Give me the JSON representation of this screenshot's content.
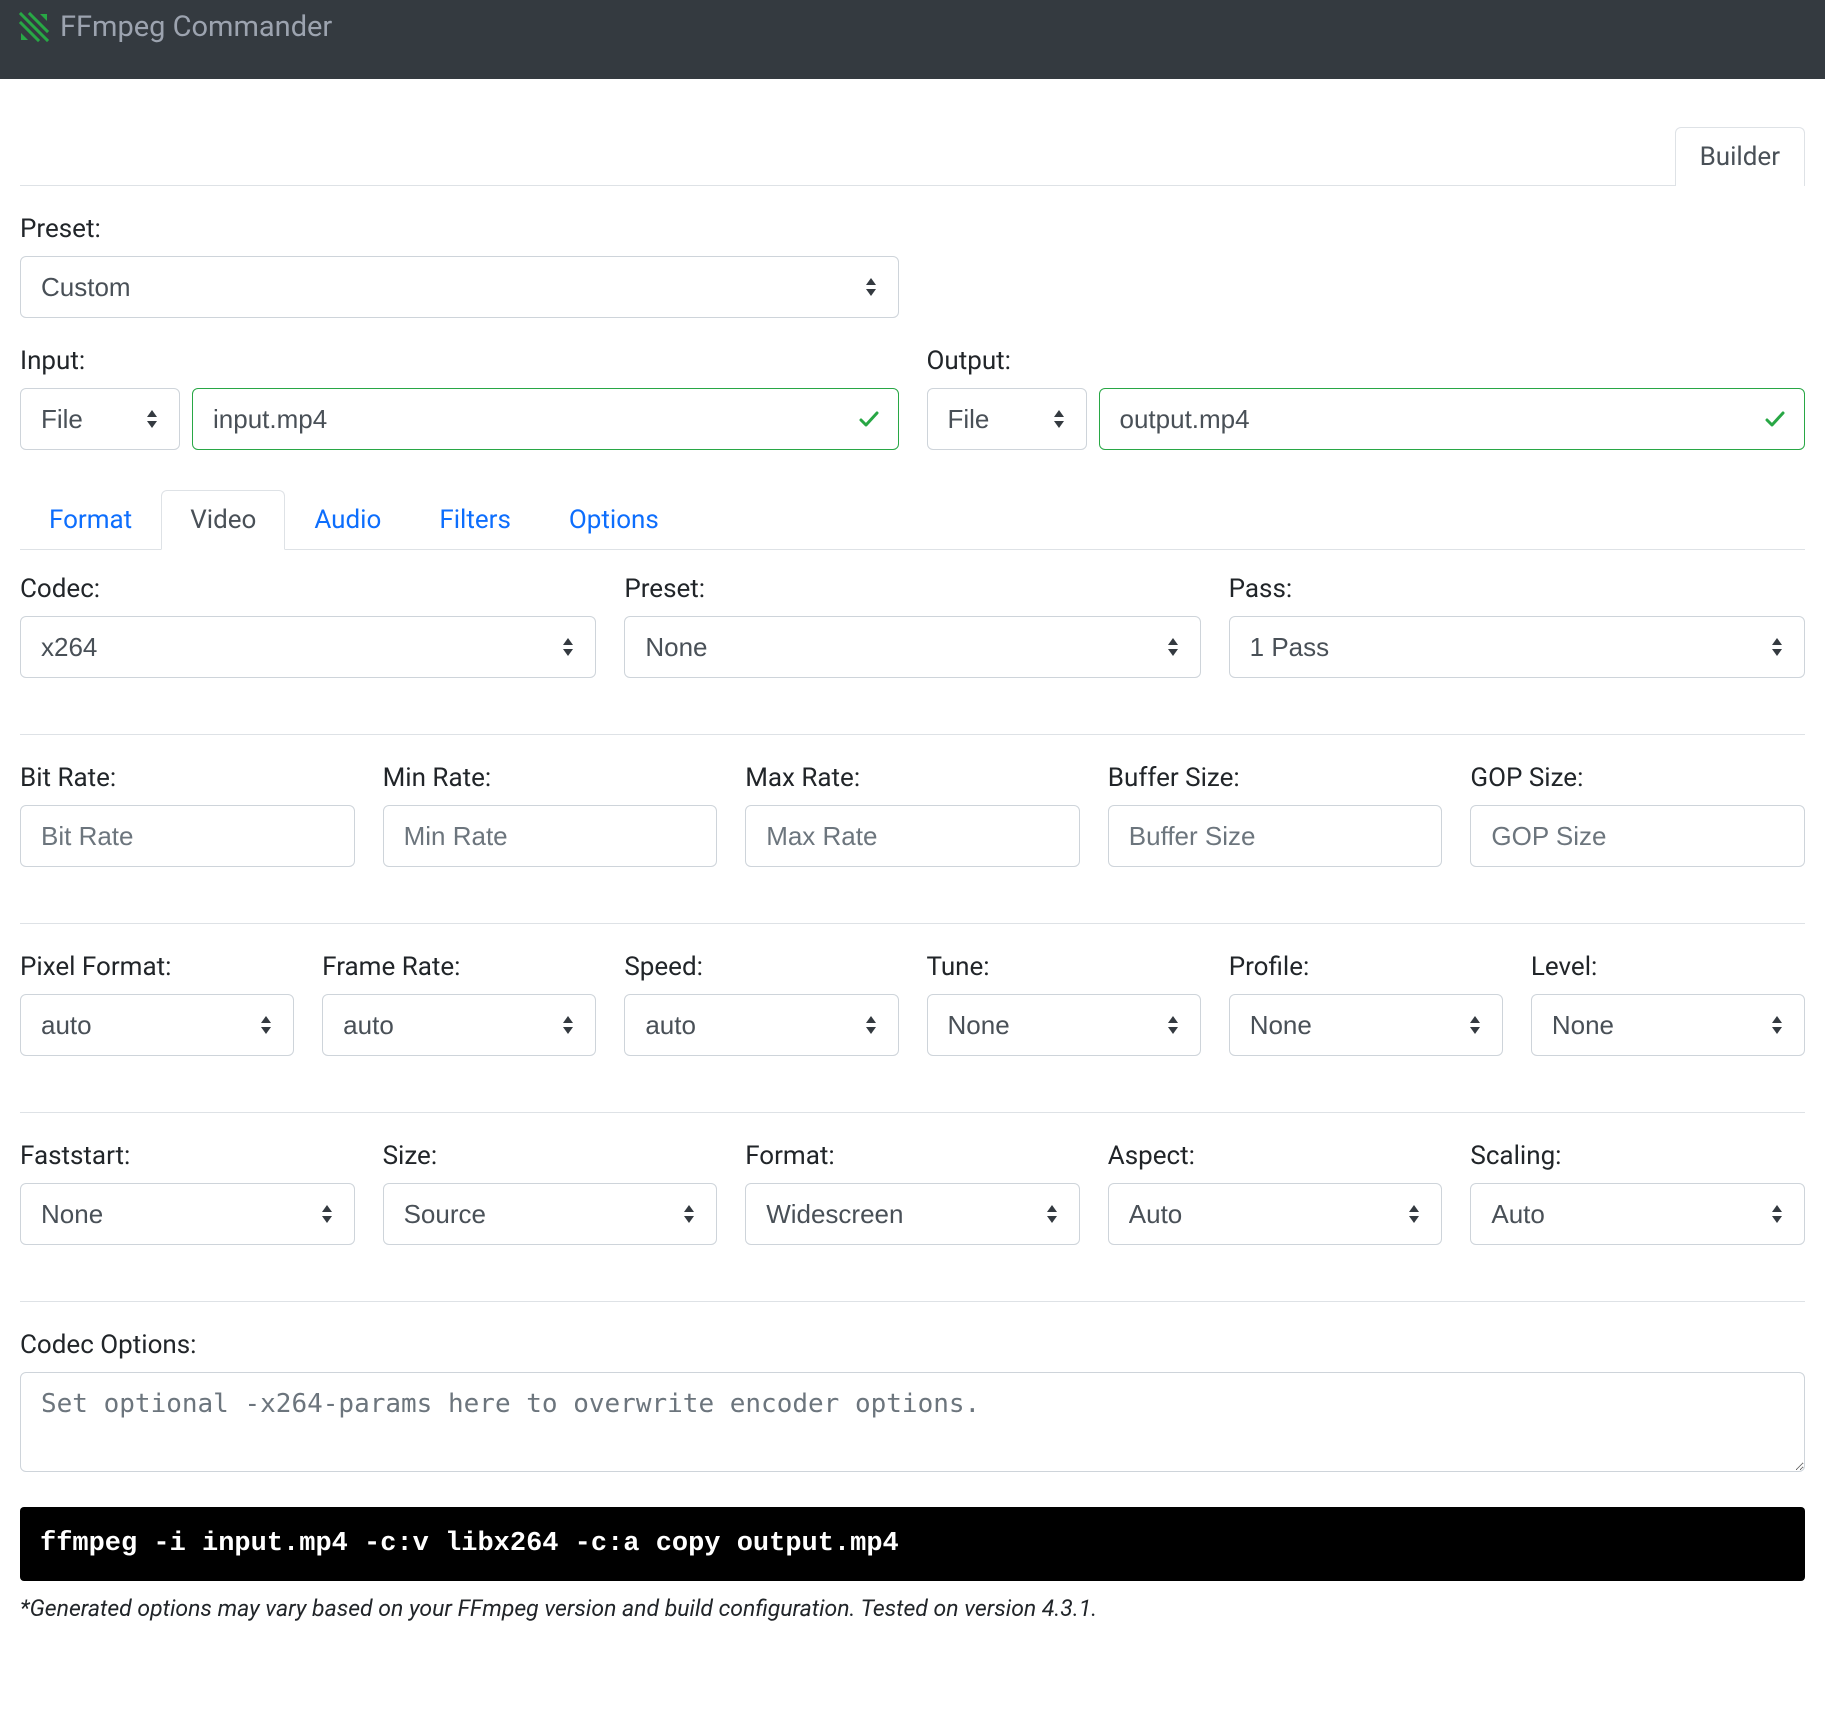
{
  "app": {
    "title": "FFmpeg Commander"
  },
  "topTabs": {
    "builder": "Builder"
  },
  "preset": {
    "label": "Preset:",
    "value": "Custom"
  },
  "input": {
    "label": "Input:",
    "type": "File",
    "value": "input.mp4"
  },
  "output": {
    "label": "Output:",
    "type": "File",
    "value": "output.mp4"
  },
  "tabs": {
    "format": "Format",
    "video": "Video",
    "audio": "Audio",
    "filters": "Filters",
    "options": "Options"
  },
  "video": {
    "codec": {
      "label": "Codec:",
      "value": "x264"
    },
    "preset": {
      "label": "Preset:",
      "value": "None"
    },
    "pass": {
      "label": "Pass:",
      "value": "1 Pass"
    },
    "bitrate": {
      "label": "Bit Rate:",
      "placeholder": "Bit Rate"
    },
    "minrate": {
      "label": "Min Rate:",
      "placeholder": "Min Rate"
    },
    "maxrate": {
      "label": "Max Rate:",
      "placeholder": "Max Rate"
    },
    "bufsize": {
      "label": "Buffer Size:",
      "placeholder": "Buffer Size"
    },
    "gop": {
      "label": "GOP Size:",
      "placeholder": "GOP Size"
    },
    "pixfmt": {
      "label": "Pixel Format:",
      "value": "auto"
    },
    "framerate": {
      "label": "Frame Rate:",
      "value": "auto"
    },
    "speed": {
      "label": "Speed:",
      "value": "auto"
    },
    "tune": {
      "label": "Tune:",
      "value": "None"
    },
    "profile": {
      "label": "Profile:",
      "value": "None"
    },
    "level": {
      "label": "Level:",
      "value": "None"
    },
    "faststart": {
      "label": "Faststart:",
      "value": "None"
    },
    "size": {
      "label": "Size:",
      "value": "Source"
    },
    "format": {
      "label": "Format:",
      "value": "Widescreen"
    },
    "aspect": {
      "label": "Aspect:",
      "value": "Auto"
    },
    "scaling": {
      "label": "Scaling:",
      "value": "Auto"
    },
    "codecOptions": {
      "label": "Codec Options:",
      "placeholder": "Set optional -x264-params here to overwrite encoder options."
    }
  },
  "command": "ffmpeg -i input.mp4 -c:v libx264 -c:a copy output.mp4",
  "footnote": "*Generated options may vary based on your FFmpeg version and build configuration. Tested on version 4.3.1."
}
